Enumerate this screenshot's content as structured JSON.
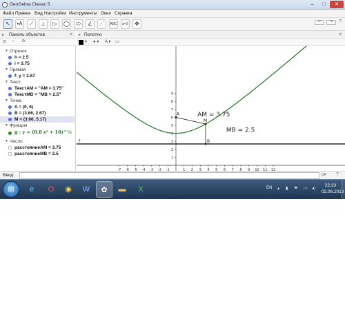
{
  "window": {
    "title": "GeoGebra Classic 5",
    "minimize": "–",
    "maximize": "□",
    "close": "✕"
  },
  "menu": [
    "Файл",
    "Правка",
    "Вид",
    "Настройки",
    "Инструменты",
    "Окно",
    "Справка"
  ],
  "toolbar": {
    "tools": [
      {
        "icon": "cursor-icon",
        "glyph": "↖"
      },
      {
        "icon": "point-icon",
        "glyph": "•A"
      },
      {
        "icon": "line-icon",
        "glyph": "⟋"
      },
      {
        "icon": "perpendicular-icon",
        "glyph": "⊥"
      },
      {
        "icon": "polygon-icon",
        "glyph": "▷"
      },
      {
        "icon": "circle-icon",
        "glyph": "◯"
      },
      {
        "icon": "ellipse-icon",
        "glyph": "⬭"
      },
      {
        "icon": "angle-icon",
        "glyph": "∠"
      },
      {
        "icon": "reflect-icon",
        "glyph": "⋰"
      },
      {
        "icon": "text-icon",
        "glyph": "ABC"
      },
      {
        "icon": "slider-icon",
        "glyph": "a=2"
      },
      {
        "icon": "move-view-icon",
        "glyph": "✥"
      }
    ],
    "undo": "↶",
    "redo": "↷",
    "help": "?"
  },
  "algebra_panel": {
    "title": "Панель объектов",
    "toggle_icons": [
      "⊡",
      "⌐",
      "fx"
    ],
    "categories": [
      {
        "label": "Отрезок",
        "items": [
          {
            "text": "h = 2.5",
            "color": "#5a6ed1",
            "selected": false
          },
          {
            "text": "i = 3.75",
            "color": "#5a6ed1",
            "selected": false
          }
        ]
      },
      {
        "label": "Прямая",
        "items": [
          {
            "text": "f: y = 2.67",
            "color": "#5a6ed1",
            "selected": false
          }
        ]
      },
      {
        "label": "Текст",
        "items": [
          {
            "text": "ТекстAM = \"AM = 3.75\"",
            "color": "#5a6ed1",
            "selected": false
          },
          {
            "text": "ТекстMB = \"MB = 2.5\"",
            "color": "#5a6ed1",
            "selected": false
          }
        ]
      },
      {
        "label": "Точка",
        "items": [
          {
            "text": "A = (0, 6)",
            "color": "#5a6ed1",
            "selected": false
          },
          {
            "text": "B = (3.66, 2.67)",
            "color": "#5a6ed1",
            "selected": false
          },
          {
            "text": "M = (3.66, 5.17)",
            "color": "#5a6ed1",
            "selected": true
          }
        ]
      },
      {
        "label": "Функция",
        "items": [
          {
            "text": "g : y = (0.8 x² + 16)^½",
            "color": "#2f8a2f",
            "selected": false
          }
        ]
      },
      {
        "label": "Число",
        "items": [
          {
            "text": "расстояниеAM = 3.75",
            "color": "",
            "selected": false
          },
          {
            "text": "расстояниеMB = 2.5",
            "color": "",
            "selected": false
          }
        ]
      }
    ]
  },
  "graphics": {
    "title": "Полотно",
    "x_ticks": [
      "-7",
      "-6",
      "-5",
      "-4",
      "-3",
      "-2",
      "-1",
      "1",
      "2",
      "3",
      "4",
      "5",
      "6",
      "7",
      "8",
      "9",
      "10",
      "11",
      "12"
    ],
    "y_ticks": [
      "9",
      "8",
      "7",
      "6",
      "5",
      "4",
      "3",
      "2",
      "1",
      "-1"
    ],
    "labels": {
      "A": "A",
      "M": "M",
      "B": "B",
      "f": "f",
      "am": "AM = 3.75",
      "mb": "MB = 2.5"
    },
    "colors": {
      "curve": "#2e7d32",
      "line": "#000000",
      "segment": "#333333",
      "point": "#333333"
    }
  },
  "input": {
    "label": "Ввод:",
    "alpha": "α▾",
    "help": "?"
  },
  "taskbar": {
    "apps": [
      {
        "icon": "ie-icon",
        "glyph": "e"
      },
      {
        "icon": "opera-icon",
        "glyph": "O"
      },
      {
        "icon": "chrome-icon",
        "glyph": "◉"
      },
      {
        "icon": "word-icon",
        "glyph": "W"
      },
      {
        "icon": "geogebra-icon",
        "glyph": "✿"
      },
      {
        "icon": "folder-icon",
        "glyph": "▬"
      },
      {
        "icon": "excel-icon",
        "glyph": "X"
      }
    ],
    "lang": "EN",
    "time": "22:33",
    "date": "02.06.2018"
  }
}
